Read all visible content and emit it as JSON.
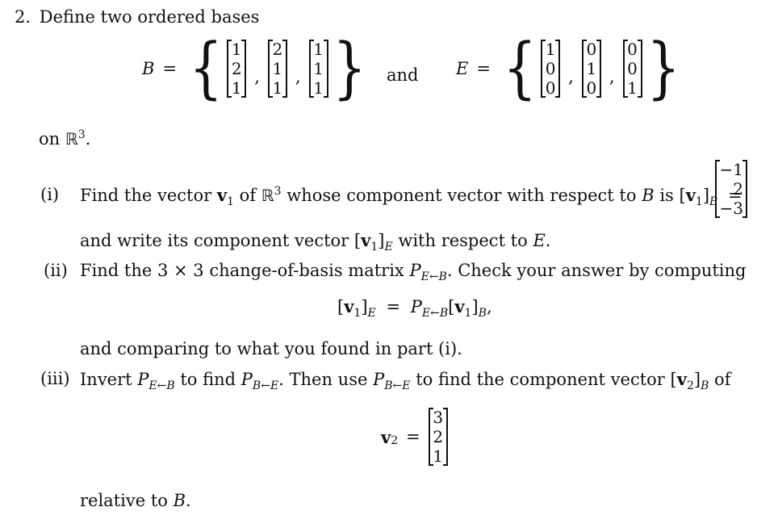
{
  "problem": {
    "number": "2.",
    "intro": "Define two ordered bases",
    "basis_B": {
      "name": "B",
      "vectors": [
        [
          "1",
          "2",
          "1"
        ],
        [
          "2",
          "1",
          "1"
        ],
        [
          "1",
          "1",
          "1"
        ]
      ]
    },
    "conjunction": "and",
    "basis_E": {
      "name": "E",
      "vectors": [
        [
          "1",
          "0",
          "0"
        ],
        [
          "0",
          "1",
          "0"
        ],
        [
          "0",
          "0",
          "1"
        ]
      ]
    },
    "space_prefix": "on",
    "space_symbol": "ℝ",
    "space_dim": "3",
    "space_suffix": ".",
    "parts": [
      {
        "label": "(i)",
        "line1_a": "Find the vector",
        "vec": "v",
        "vec_sub": "1",
        "line1_b": "of",
        "line1_c": "whose component vector with respect to",
        "line1_d": "is",
        "given_vector": [
          "−1",
          "2",
          "−3"
        ],
        "line2_a": "and write its component vector",
        "line2_b": "with respect to",
        "line2_end": "."
      },
      {
        "label": "(ii)",
        "line1_a": "Find the 3 × 3 change-of-basis matrix",
        "line1_b": ". Check your answer by computing",
        "matrix_name": "P",
        "matrix_sub": "E←B",
        "equation_suffix": ",",
        "line2": "and comparing to what you found in part (i)."
      },
      {
        "label": "(iii)",
        "line1_a": "Invert",
        "line1_b": "to find",
        "line1_c": ". Then use",
        "line1_d": "to find the component vector",
        "line1_e": "of",
        "inverse_sub": "B←E",
        "vec2": "v",
        "vec2_sub": "2",
        "vector_v2": [
          "3",
          "2",
          "1"
        ],
        "closing": "relative to",
        "closing_end": "."
      }
    ]
  }
}
